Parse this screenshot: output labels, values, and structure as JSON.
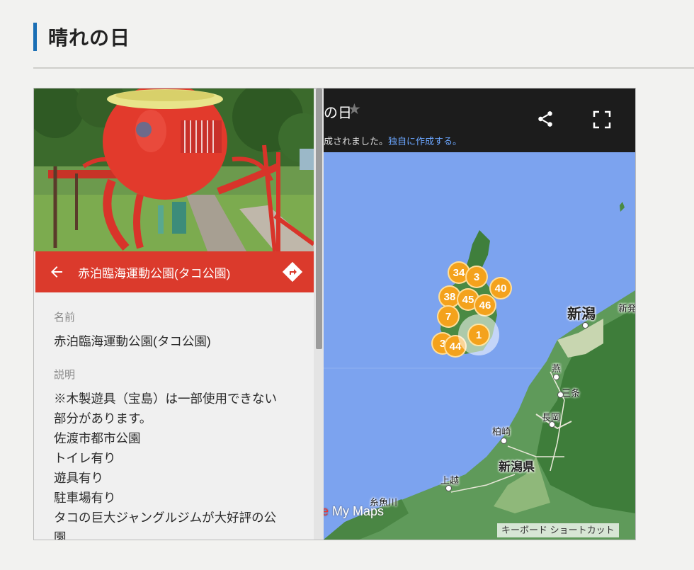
{
  "page": {
    "heading": "晴れの日"
  },
  "panel": {
    "title": "赤泊臨海運動公園(タコ公園)",
    "name_label": "名前",
    "name_value": "赤泊臨海運動公園(タコ公園)",
    "description_label": "説明",
    "description_lines": [
      "※木製遊具（宝島）は一部使用できない",
      "部分があります。",
      "佐渡市都市公園",
      "トイレ有り",
      "遊具有り",
      "駐車場有り",
      "タコの巨大ジャングルジムが大好評の公",
      "園"
    ]
  },
  "map": {
    "title_fragment": "の日",
    "notice_text": "成されました。",
    "notice_link": "独自に作成する。",
    "logo_text": "My Maps",
    "logo_prefix": "e",
    "keyboard_shortcuts": "キーボード ショートカット",
    "clusters": [
      "34",
      "3",
      "38",
      "45",
      "40",
      "46",
      "7",
      "3",
      "44",
      "1"
    ],
    "places": {
      "niigata_city": "新潟",
      "niigata_pref": "新潟県",
      "tsubame": "燕",
      "sanjo": "三条",
      "nagaoka": "長岡",
      "kashiwazaki": "柏崎",
      "joetsu": "上越",
      "itoigawa": "糸魚川",
      "shinhatsu": "新発"
    }
  },
  "colors": {
    "accent_bar": "#1a6fb5",
    "panel_header": "#db3a2c",
    "cluster": "#f4a21c",
    "sea": "#7ca3ef",
    "link": "#6ba6ff"
  }
}
